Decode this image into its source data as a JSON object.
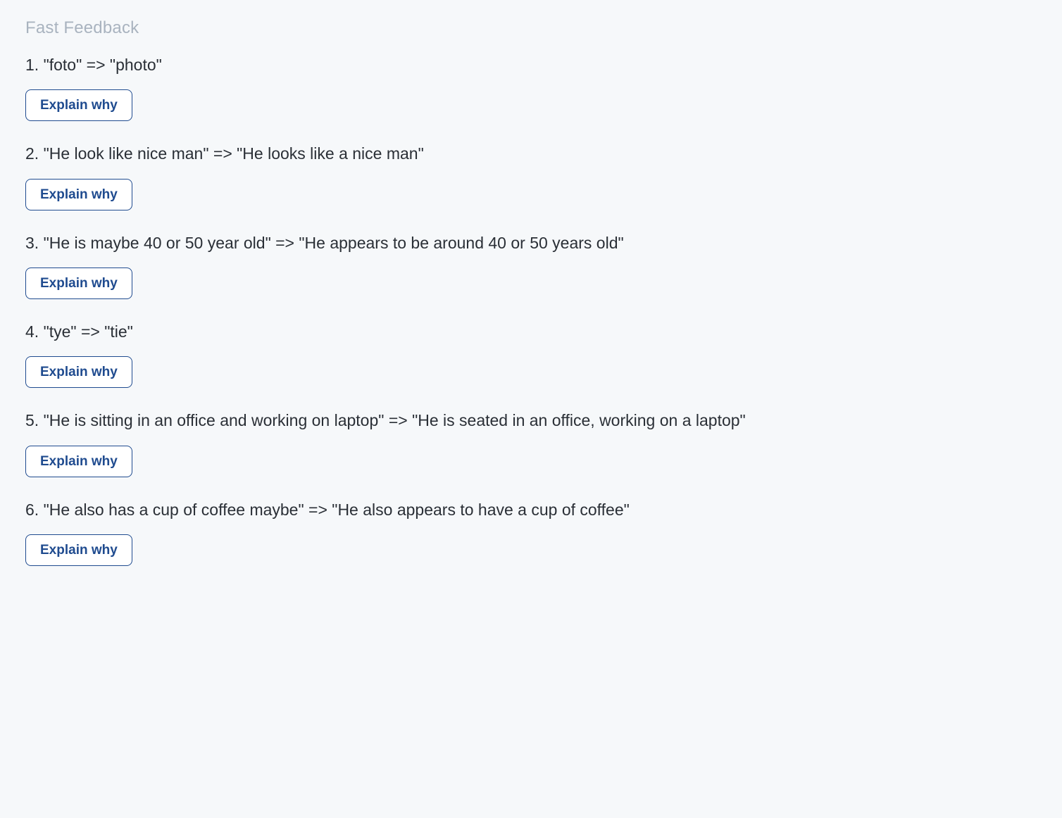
{
  "section_title": "Fast Feedback",
  "explain_label": "Explain why",
  "items": [
    {
      "num": "1",
      "from": "foto",
      "to": "photo"
    },
    {
      "num": "2",
      "from": "He look like nice man",
      "to": "He looks like a nice man"
    },
    {
      "num": "3",
      "from": "He is maybe 40 or 50 year old",
      "to": "He appears to be around 40 or 50 years old"
    },
    {
      "num": "4",
      "from": "tye",
      "to": "tie"
    },
    {
      "num": "5",
      "from": "He is sitting in an office and working on laptop",
      "to": "He is seated in an office, working on a laptop"
    },
    {
      "num": "6",
      "from": "He also has a cup of coffee maybe",
      "to": "He also appears to have a cup of coffee"
    }
  ]
}
